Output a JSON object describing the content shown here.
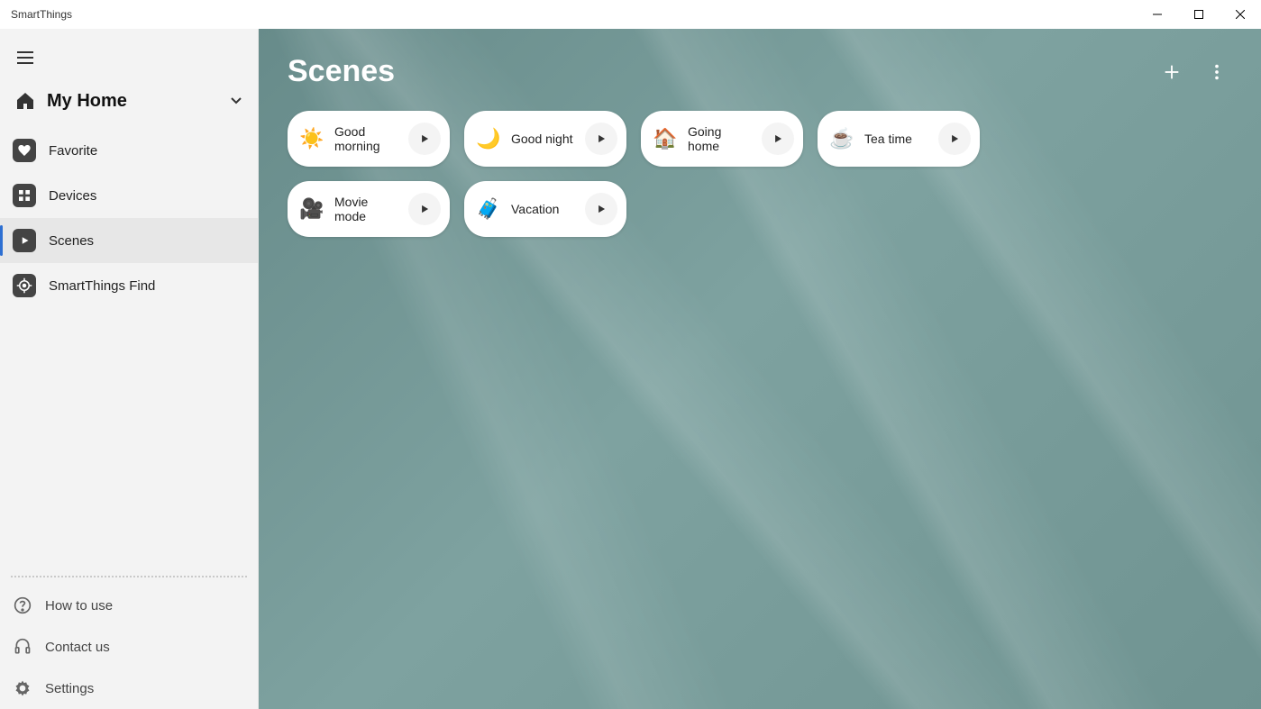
{
  "window": {
    "title": "SmartThings"
  },
  "sidebar": {
    "home_label": "My Home",
    "items": [
      {
        "label": "Favorite"
      },
      {
        "label": "Devices"
      },
      {
        "label": "Scenes"
      },
      {
        "label": "SmartThings Find"
      }
    ],
    "footer": [
      {
        "label": "How to use"
      },
      {
        "label": "Contact us"
      },
      {
        "label": "Settings"
      }
    ]
  },
  "page": {
    "title": "Scenes"
  },
  "scenes": [
    {
      "emoji": "☀️",
      "label": "Good morning"
    },
    {
      "emoji": "🌙",
      "label": "Good night"
    },
    {
      "emoji": "🏠",
      "label": "Going home"
    },
    {
      "emoji": "☕",
      "label": "Tea time"
    },
    {
      "emoji": "🎥",
      "label": "Movie mode"
    },
    {
      "emoji": "🧳",
      "label": "Vacation"
    }
  ]
}
